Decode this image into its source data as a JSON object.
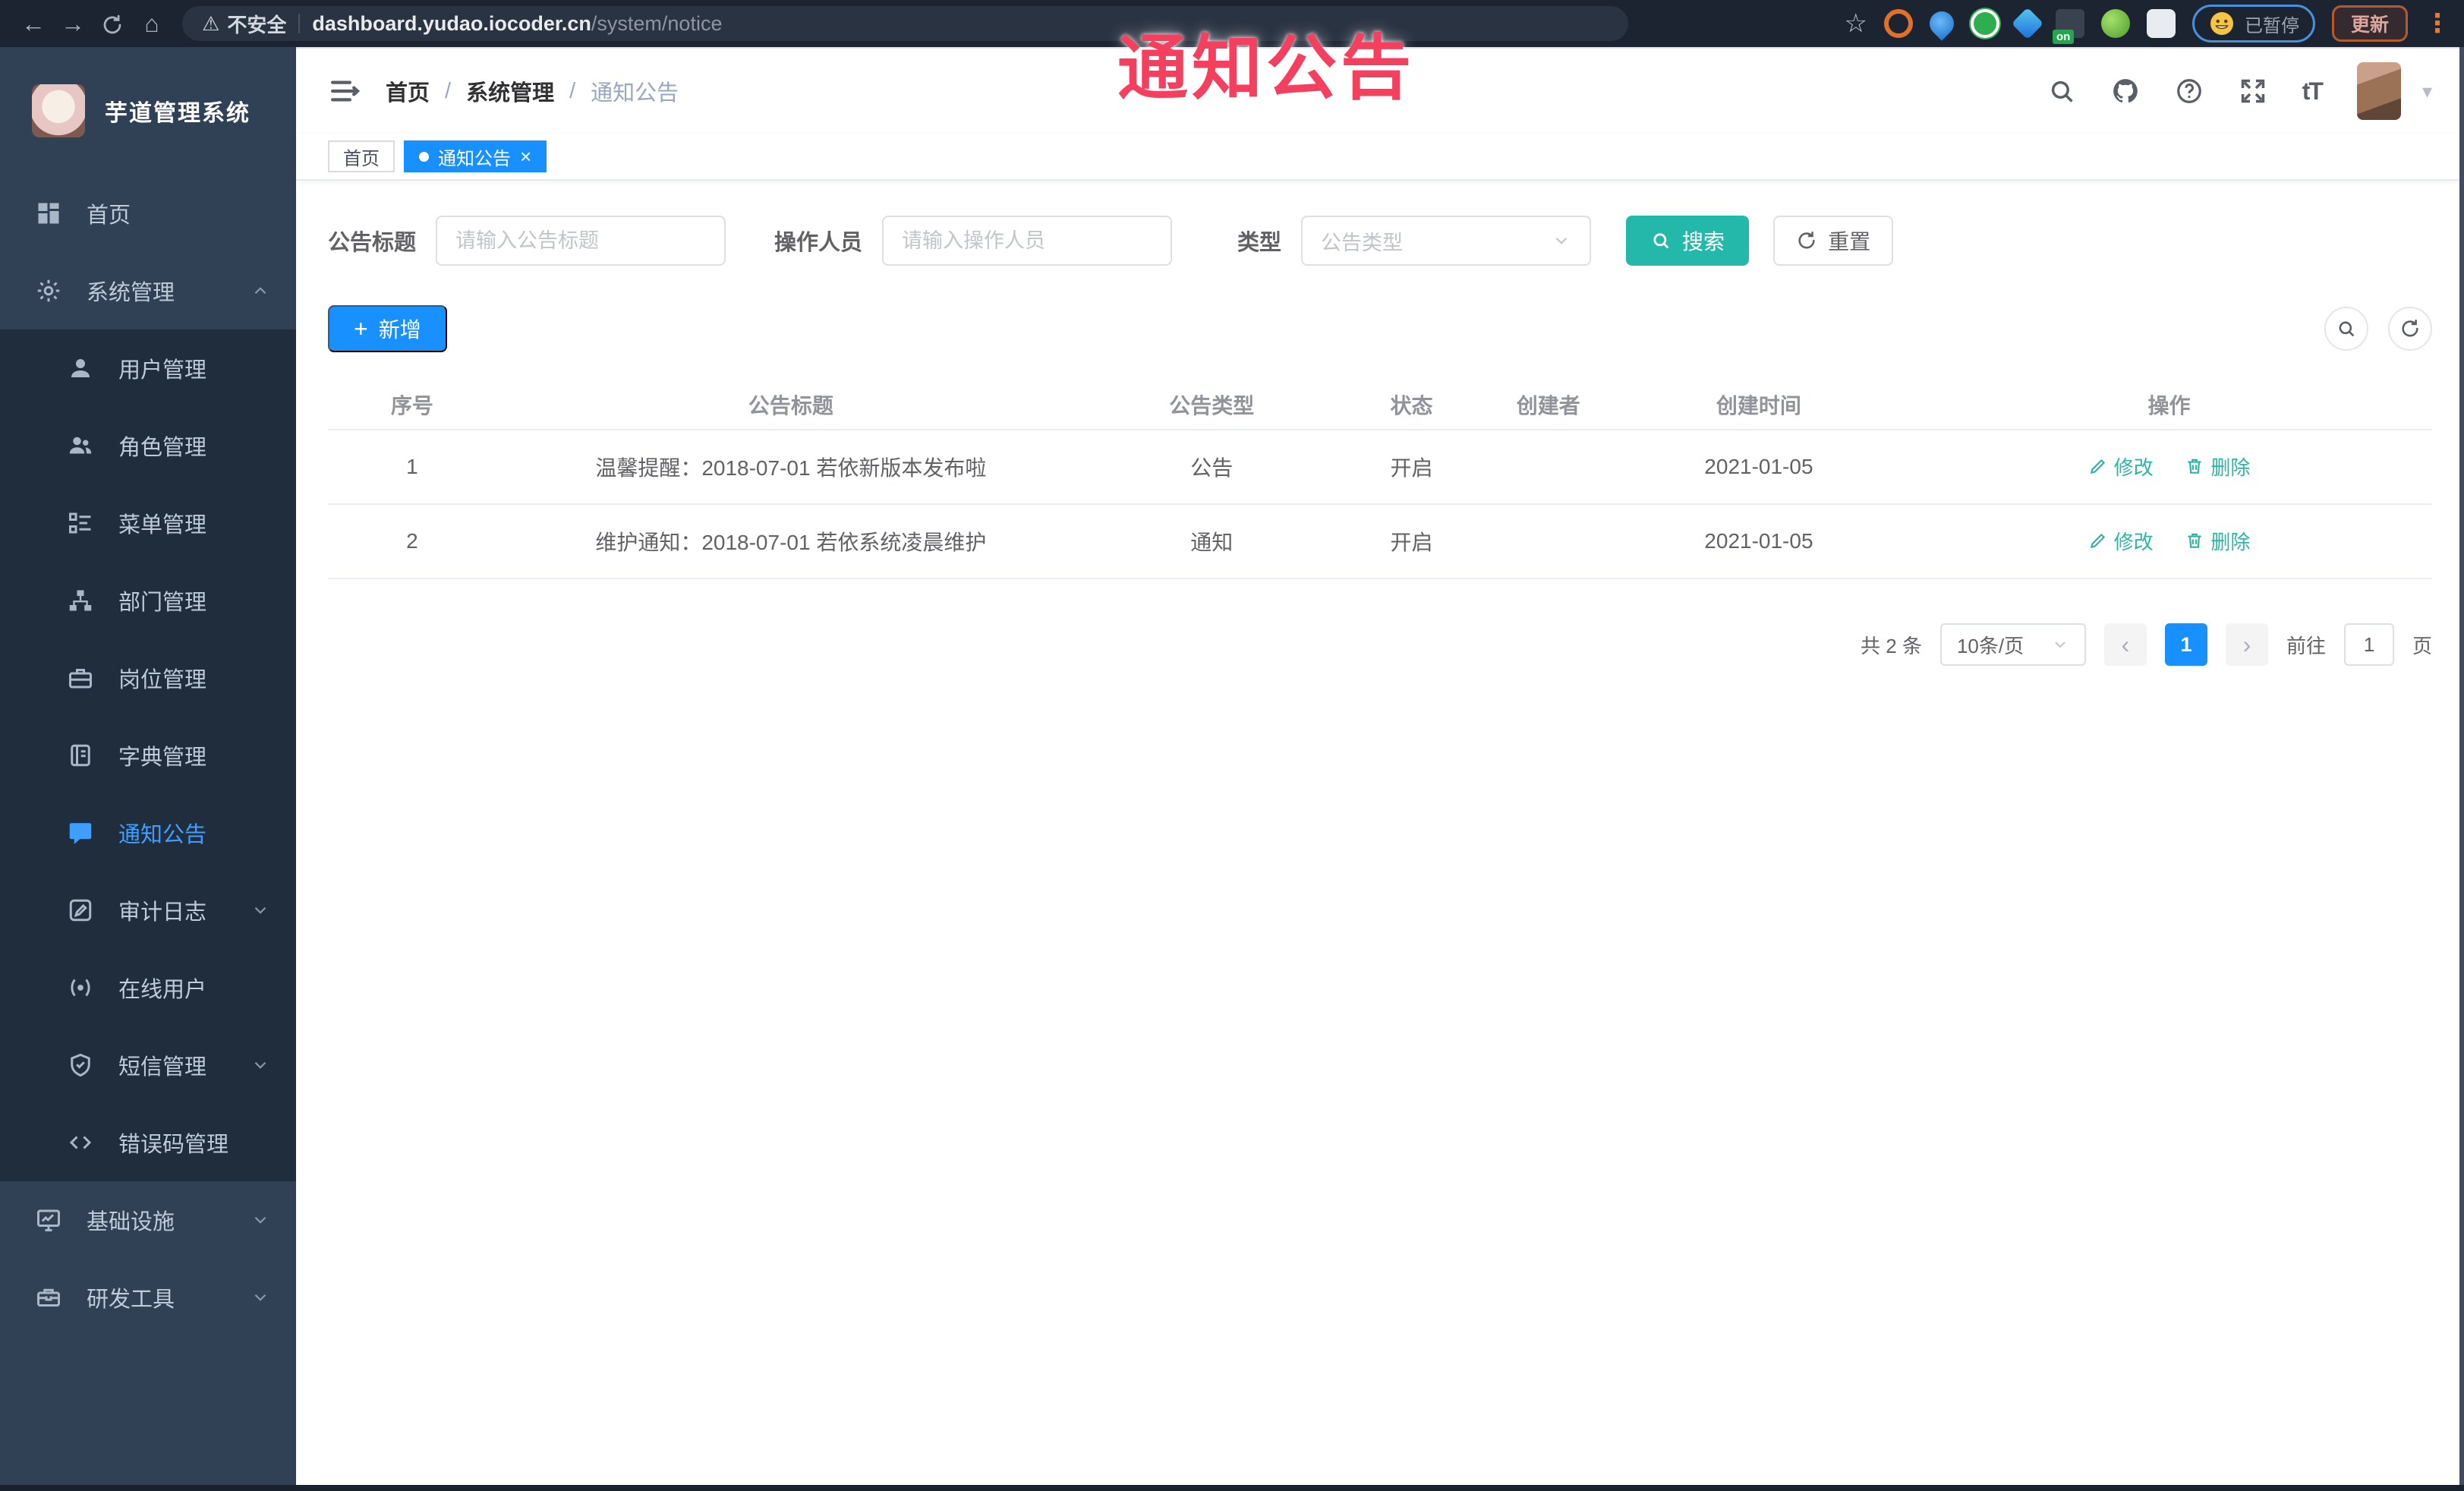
{
  "browser": {
    "back": "←",
    "forward": "→",
    "home": "⌂",
    "warning": "⚠",
    "security": "不安全",
    "host": "dashboard.yudao.iocoder.cn",
    "path": "/system/notice",
    "star": "☆",
    "ext_on_badge": "on",
    "paused": "已暂停",
    "update": "更新",
    "menu_dots": "⋮"
  },
  "overlay": {
    "text": "通知公告",
    "color": "#f43f5e"
  },
  "sidebar": {
    "title": "芋道管理系统",
    "home": "首页",
    "system": "系统管理",
    "submenu": [
      {
        "label": "用户管理"
      },
      {
        "label": "角色管理"
      },
      {
        "label": "菜单管理"
      },
      {
        "label": "部门管理"
      },
      {
        "label": "岗位管理"
      },
      {
        "label": "字典管理"
      },
      {
        "label": "通知公告"
      },
      {
        "label": "审计日志"
      },
      {
        "label": "在线用户"
      },
      {
        "label": "短信管理"
      },
      {
        "label": "错误码管理"
      }
    ],
    "infra": "基础设施",
    "devtools": "研发工具"
  },
  "navbar": {
    "breadcrumb": [
      "首页",
      "系统管理",
      "通知公告"
    ],
    "separator": "/",
    "font_size_glyph": "tT"
  },
  "tags": {
    "home": "首页",
    "active": "通知公告",
    "close": "×"
  },
  "filter": {
    "title_label": "公告标题",
    "title_placeholder": "请输入公告标题",
    "operator_label": "操作人员",
    "operator_placeholder": "请输入操作人员",
    "type_label": "类型",
    "type_placeholder": "公告类型",
    "search": "搜索",
    "reset": "重置"
  },
  "toolbar": {
    "add": "新增",
    "plus": "+"
  },
  "table": {
    "headers": [
      "序号",
      "公告标题",
      "公告类型",
      "状态",
      "创建者",
      "创建时间",
      "操作"
    ],
    "rows": [
      {
        "no": "1",
        "title": "温馨提醒：2018-07-01 若依新版本发布啦",
        "type": "公告",
        "status": "开启",
        "creator": "",
        "created": "2021-01-05"
      },
      {
        "no": "2",
        "title": "维护通知：2018-07-01 若依系统凌晨维护",
        "type": "通知",
        "status": "开启",
        "creator": "",
        "created": "2021-01-05"
      }
    ],
    "edit": "修改",
    "delete": "删除"
  },
  "pagination": {
    "total": "共 2 条",
    "per_page": "10条/页",
    "prev": "‹",
    "page": "1",
    "next": "›",
    "goto_label": "前往",
    "goto_value": "1",
    "unit": "页"
  },
  "colors": {
    "accent_blue": "#1890ff",
    "teal": "#23b8a9",
    "overlay_red": "#f43f5e",
    "sidebar_bg": "#304156",
    "submenu_bg": "#1f2d3d"
  }
}
